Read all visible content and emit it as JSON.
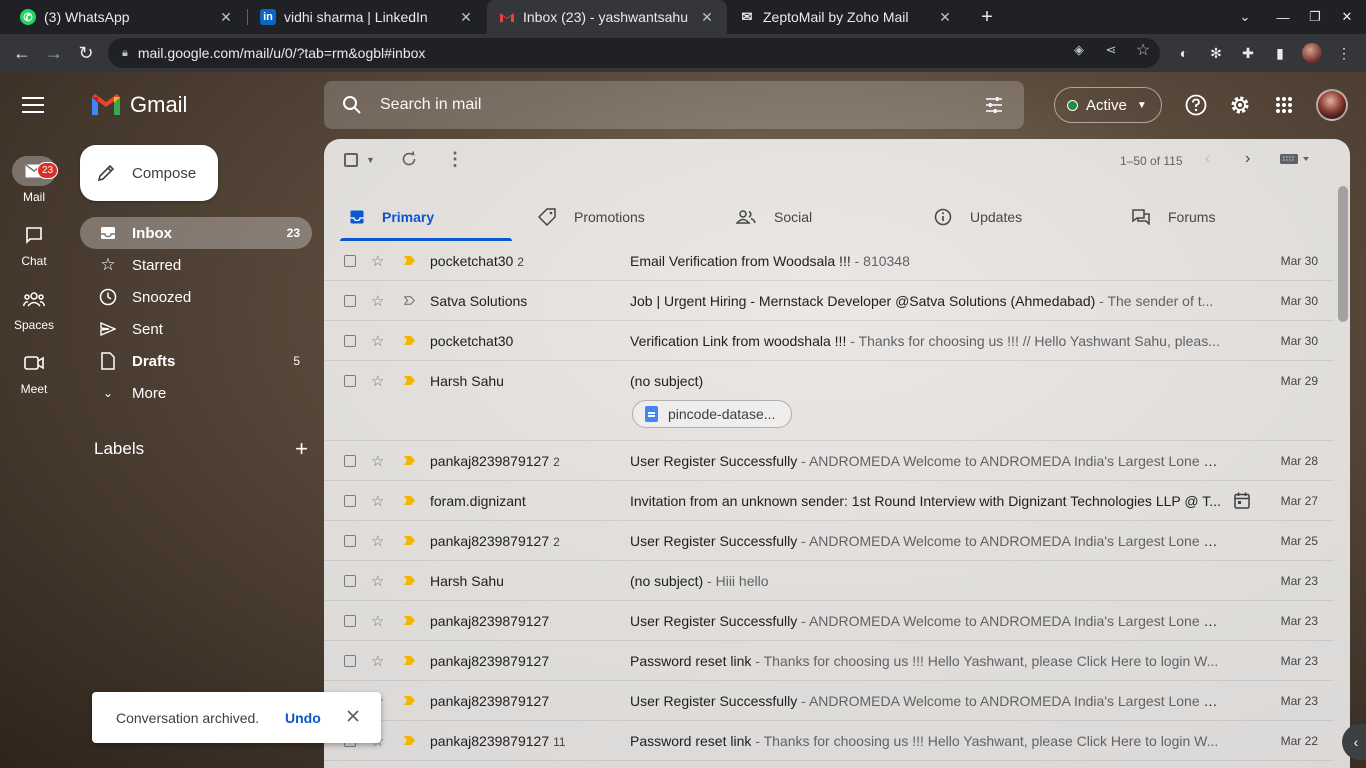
{
  "browser": {
    "tabs": [
      {
        "title": "(3) WhatsApp"
      },
      {
        "title": "vidhi sharma | LinkedIn"
      },
      {
        "title": "Inbox (23) - yashwantsahu"
      },
      {
        "title": "ZeptoMail by Zoho Mail"
      }
    ],
    "url": "mail.google.com/mail/u/0/?tab=rm&ogbl#inbox"
  },
  "gmail": {
    "brand": "Gmail",
    "rail": [
      {
        "label": "Mail",
        "badge": "23"
      },
      {
        "label": "Chat"
      },
      {
        "label": "Spaces"
      },
      {
        "label": "Meet"
      }
    ],
    "search": {
      "placeholder": "Search in mail"
    },
    "status": "Active",
    "compose": "Compose",
    "nav": [
      {
        "label": "Inbox",
        "count": "23"
      },
      {
        "label": "Starred",
        "count": ""
      },
      {
        "label": "Snoozed",
        "count": ""
      },
      {
        "label": "Sent",
        "count": ""
      },
      {
        "label": "Drafts",
        "count": "5"
      },
      {
        "label": "More",
        "count": ""
      }
    ],
    "labels_heading": "Labels",
    "pagination": "1–50 of 115",
    "categories": [
      {
        "label": "Primary"
      },
      {
        "label": "Promotions"
      },
      {
        "label": "Social"
      },
      {
        "label": "Updates"
      },
      {
        "label": "Forums"
      }
    ],
    "emails": [
      {
        "from": "pocketchat30",
        "count": "2",
        "subject": "Email Verification from Woodsala !!!",
        "snippet": " - 810348",
        "date": "Mar 30"
      },
      {
        "from": "Satva Solutions",
        "count": "",
        "subject": "Job | Urgent Hiring - Mernstack Developer @Satva Solutions (Ahmedabad)",
        "snippet": " - The sender of t...",
        "date": "Mar 30"
      },
      {
        "from": "pocketchat30",
        "count": "",
        "subject": "Verification Link from woodshala !!!",
        "snippet": " - Thanks for choosing us !!! // Hello Yashwant Sahu, pleas...",
        "date": "Mar 30"
      },
      {
        "from": "Harsh Sahu",
        "count": "",
        "subject": "(no subject)",
        "snippet": "",
        "date": "Mar 29",
        "attachment": "pincode-datase..."
      },
      {
        "from": "pankaj8239879127",
        "count": "2",
        "subject": "User Register Successfully",
        "snippet": " - ANDROMEDA Welcome to ANDROMEDA India's Largest Lone Di...",
        "date": "Mar 28"
      },
      {
        "from": "foram.dignizant",
        "count": "",
        "subject": "Invitation from an unknown sender: 1st Round Interview with Dignizant Technologies LLP @ T...",
        "snippet": "",
        "date": "Mar 27"
      },
      {
        "from": "pankaj8239879127",
        "count": "2",
        "subject": "User Register Successfully",
        "snippet": " - ANDROMEDA Welcome to ANDROMEDA India's Largest Lone Di...",
        "date": "Mar 25"
      },
      {
        "from": "Harsh Sahu",
        "count": "",
        "subject": "(no subject)",
        "snippet": " - Hiii hello",
        "date": "Mar 23"
      },
      {
        "from": "pankaj8239879127",
        "count": "",
        "subject": "User Register Successfully",
        "snippet": " - ANDROMEDA Welcome to ANDROMEDA India's Largest Lone Di...",
        "date": "Mar 23"
      },
      {
        "from": "pankaj8239879127",
        "count": "",
        "subject": "Password reset link",
        "snippet": " - Thanks for choosing us !!! Hello Yashwant, please Click Here to login W...",
        "date": "Mar 23"
      },
      {
        "from": "pankaj8239879127",
        "count": "",
        "subject": "User Register Successfully",
        "snippet": " - ANDROMEDA Welcome to ANDROMEDA India's Largest Lone Di...",
        "date": "Mar 23"
      },
      {
        "from": "pankaj8239879127",
        "count": "11",
        "subject": "Password reset link",
        "snippet": " - Thanks for choosing us !!! Hello Yashwant, please Click Here to login W...",
        "date": "Mar 22"
      }
    ],
    "toast": {
      "message": "Conversation archived.",
      "action": "Undo"
    }
  },
  "colors": {
    "accent": "#0b57d0",
    "important": "#f2b600",
    "badge": "#d93025",
    "active_dot": "#1e8e3e"
  }
}
